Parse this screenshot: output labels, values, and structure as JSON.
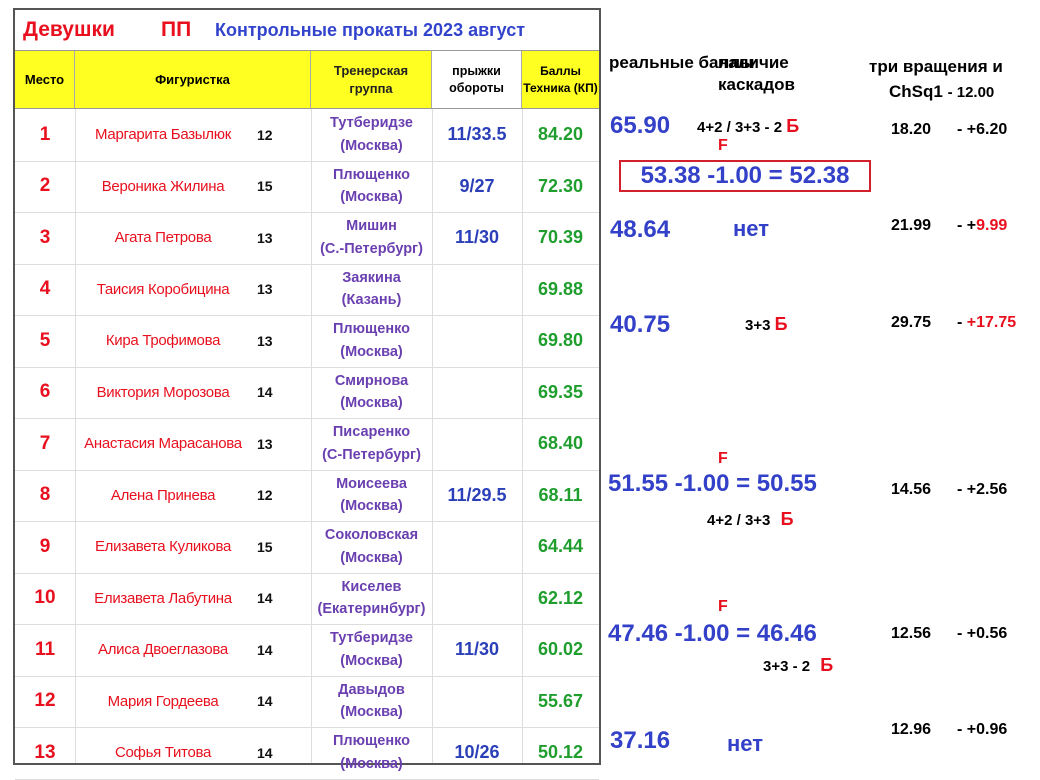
{
  "title": {
    "main": "Девушки",
    "sub": "ПП",
    "event": "Контрольные прокаты 2023 август"
  },
  "headers": {
    "place": "Место",
    "name": "Фигуристка",
    "group": "Тренерская группа",
    "jumps": "прыжки обороты",
    "score": "Баллы Техника (КП)"
  },
  "rows": [
    {
      "place": "1",
      "name": "Маргарита Базылюк",
      "age": "12",
      "coach": "Тутберидзе",
      "city": "(Москва)",
      "jumps": "11/33.5",
      "score": "84.20"
    },
    {
      "place": "2",
      "name": "Вероника Жилина",
      "age": "15",
      "coach": "Плющенко",
      "city": "(Москва)",
      "jumps": "9/27",
      "score": "72.30"
    },
    {
      "place": "3",
      "name": "Агата Петрова",
      "age": "13",
      "coach": "Мишин",
      "city": "(С.-Петербург)",
      "jumps": "11/30",
      "score": "70.39"
    },
    {
      "place": "4",
      "name": "Таисия Коробицина",
      "age": "13",
      "coach": "Заякина",
      "city": "(Казань)",
      "jumps": "",
      "score": "69.88"
    },
    {
      "place": "5",
      "name": "Кира Трофимова",
      "age": "13",
      "coach": "Плющенко",
      "city": "(Москва)",
      "jumps": "",
      "score": "69.80"
    },
    {
      "place": "6",
      "name": "Виктория Морозова",
      "age": "14",
      "coach": "Смирнова",
      "city": "(Москва)",
      "jumps": "",
      "score": "69.35"
    },
    {
      "place": "7",
      "name": "Анастасия Марасанова",
      "age": "13",
      "coach": "Писаренко",
      "city": "(С-Петербург)",
      "jumps": "",
      "score": "68.40"
    },
    {
      "place": "8",
      "name": "Алена Принева",
      "age": "12",
      "coach": "Моисеева",
      "city": "(Москва)",
      "jumps": "11/29.5",
      "score": "68.11"
    },
    {
      "place": "9",
      "name": "Елизавета Куликова",
      "age": "15",
      "coach": "Соколовская",
      "city": "(Москва)",
      "jumps": "",
      "score": "64.44"
    },
    {
      "place": "10",
      "name": "Елизавета Лабутина",
      "age": "14",
      "coach": "Киселев",
      "city": "(Екатеринбург)",
      "jumps": "",
      "score": "62.12"
    },
    {
      "place": "11",
      "name": "Алиса Двоеглазова",
      "age": "14",
      "coach": "Тутберидзе",
      "city": "(Москва)",
      "jumps": "11/30",
      "score": "60.02"
    },
    {
      "place": "12",
      "name": "Мария Гордеева",
      "age": "14",
      "coach": "Давыдов",
      "city": "(Москва)",
      "jumps": "",
      "score": "55.67"
    },
    {
      "place": "13",
      "name": "Софья Титова",
      "age": "14",
      "coach": "Плющенко",
      "city": "(Москва)",
      "jumps": "10/26",
      "score": "50.12"
    }
  ],
  "right": {
    "hdr_real": "реальные баллы",
    "hdr_casc": "наличие каскадов",
    "hdr_spin_1": "три вращения  и",
    "hdr_spin_2": "ChSq1",
    "hdr_spin_3": "- 12.00",
    "r1_real": "65.90",
    "r1_casc": "4+2 / 3+3 - 2",
    "r1_b": "Б",
    "r1_spin": "18.20",
    "r1_diff": "- +6.20",
    "r2_f": "F",
    "r2_box": "53.38 -1.00 = 52.38",
    "r3_real": "48.64",
    "r3_casc": "нет",
    "r3_spin": "21.99",
    "r3_diff_pre": "- +",
    "r3_diff": "9.99",
    "r5_real": "40.75",
    "r5_casc": "3+3",
    "r5_b": "Б",
    "r5_spin": "29.75",
    "r5_diff_pre": "-",
    "r5_diff": "+17.75",
    "r8_f": "F",
    "r8_real": "51.55 -1.00 = 50.55",
    "r8_spin": "14.56",
    "r8_diff": "- +2.56",
    "r9_casc": "4+2 / 3+3",
    "r9_b": "Б",
    "r11_f": "F",
    "r11_real": "47.46 -1.00 = 46.46",
    "r11_spin": "12.56",
    "r11_diff": "- +0.56",
    "r12_casc": "3+3 - 2",
    "r12_b": "Б",
    "r13_real": "37.16",
    "r13_casc": "нет",
    "r13_spin": "12.96",
    "r13_diff": "- +0.96"
  }
}
